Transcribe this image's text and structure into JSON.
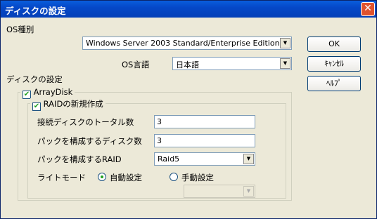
{
  "window": {
    "title": "ディスクの設定",
    "close_glyph": "✕"
  },
  "os_type": {
    "label": "OS種別",
    "value": "Windows Server 2003 Standard/Enterprise Edition"
  },
  "os_lang": {
    "label": "OS言語",
    "value": "日本語"
  },
  "disk_settings": {
    "label": "ディスクの設定"
  },
  "array_disk": {
    "label": "ArrayDisk",
    "checked": true,
    "check_glyph": "✔"
  },
  "raid_new": {
    "label": "RAIDの新規作成",
    "checked": true,
    "check_glyph": "✔"
  },
  "total_disks": {
    "label": "接続ディスクのトータル数",
    "value": "3"
  },
  "pack_disks": {
    "label": "パックを構成するディスク数",
    "value": "3"
  },
  "pack_raid": {
    "label": "パックを構成するRAID",
    "value": "Raid5"
  },
  "write_mode": {
    "label": "ライトモード",
    "auto_label": "自動設定",
    "manual_label": "手動設定",
    "selected": "auto",
    "manual_value": ""
  },
  "buttons": {
    "ok": "OK",
    "cancel": "ｷｬﾝｾﾙ",
    "help": "ﾍﾙﾌﾟ"
  },
  "icons": {
    "dropdown": "▼"
  }
}
